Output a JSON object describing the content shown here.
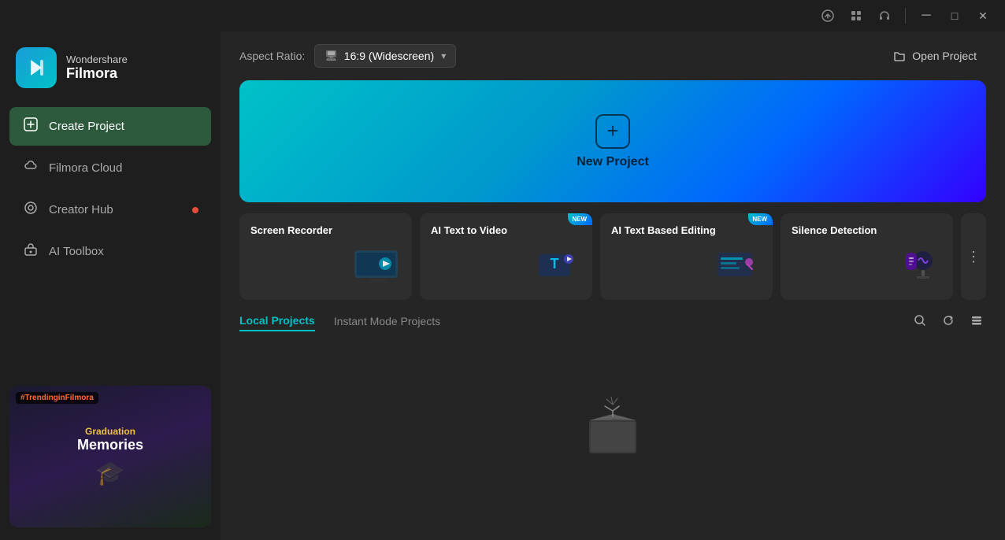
{
  "titlebar": {
    "upload_icon": "⬆",
    "grid_icon": "⊞",
    "headphone_icon": "🎧",
    "minimize_icon": "─",
    "restore_icon": "□",
    "close_icon": "✕"
  },
  "sidebar": {
    "logo": {
      "brand": "Wondershare",
      "product": "Filmora"
    },
    "nav_items": [
      {
        "id": "create-project",
        "label": "Create Project",
        "icon": "⊕",
        "active": true,
        "badge": false
      },
      {
        "id": "filmora-cloud",
        "label": "Filmora Cloud",
        "icon": "☁",
        "active": false,
        "badge": false
      },
      {
        "id": "creator-hub",
        "label": "Creator Hub",
        "icon": "◎",
        "active": false,
        "badge": true
      },
      {
        "id": "ai-toolbox",
        "label": "AI Toolbox",
        "icon": "🤖",
        "active": false,
        "badge": false
      }
    ],
    "promo": {
      "tag": "#TrendinginFilmora",
      "line1": "Graduation",
      "line2": "Memories"
    }
  },
  "header": {
    "aspect_label": "Aspect Ratio:",
    "aspect_value": "16:9 (Widescreen)",
    "open_project_label": "Open Project"
  },
  "new_project": {
    "label": "New Project"
  },
  "feature_cards": [
    {
      "id": "screen-recorder",
      "label": "Screen Recorder",
      "new": false
    },
    {
      "id": "ai-text-to-video",
      "label": "AI Text to Video",
      "new": true
    },
    {
      "id": "ai-text-based-editing",
      "label": "AI Text Based Editing",
      "new": true
    },
    {
      "id": "silence-detection",
      "label": "Silence Detection",
      "new": false
    }
  ],
  "projects": {
    "tabs": [
      {
        "id": "local",
        "label": "Local Projects",
        "active": true
      },
      {
        "id": "instant",
        "label": "Instant Mode Projects",
        "active": false
      }
    ],
    "actions": {
      "search": "🔍",
      "refresh": "↻",
      "view": "⊟"
    },
    "empty_state": true
  }
}
